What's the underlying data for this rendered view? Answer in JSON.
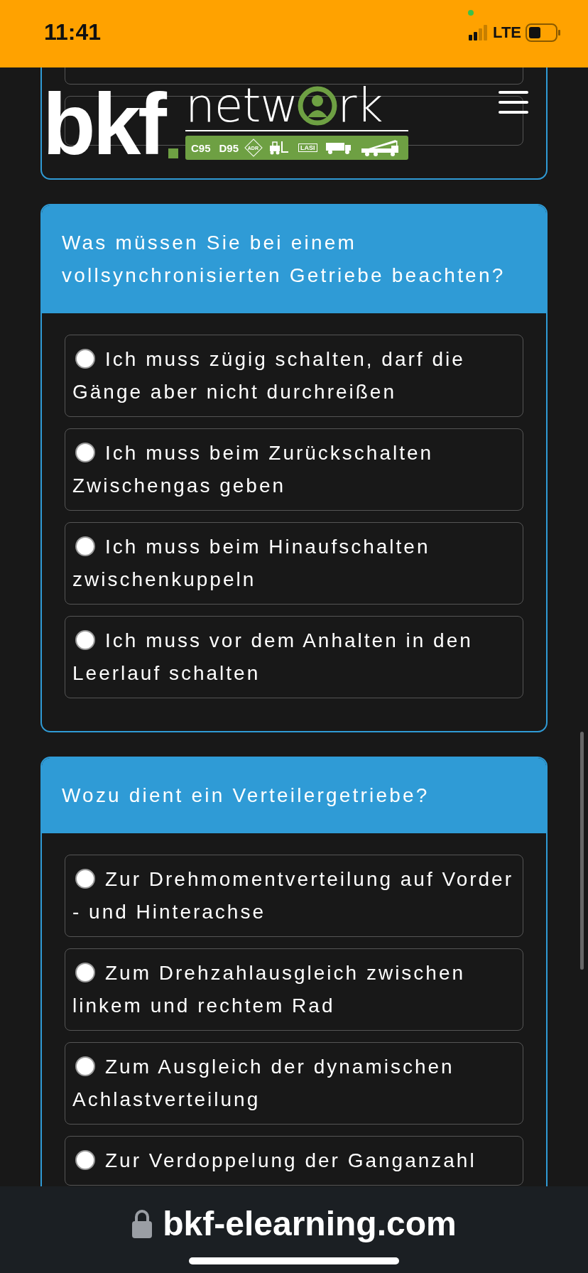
{
  "status_bar": {
    "time": "11:41",
    "network": "LTE"
  },
  "header": {
    "logo": {
      "brand": "bkf",
      "word_start": "netw",
      "word_end": "rk",
      "badges": [
        "C95",
        "D95",
        "ADR",
        "LASI"
      ]
    }
  },
  "questions": [
    {
      "options": [
        {
          "kind": "cut"
        },
        {
          "kind": "cut"
        }
      ]
    },
    {
      "question": "Was müssen Sie bei einem vollsynchronisierten Getriebe beachten?",
      "options": [
        {
          "kind": "radio",
          "text": "Ich muss zügig schalten, darf die Gänge aber nicht durchreißen",
          "selected": false
        },
        {
          "kind": "radio",
          "text": "Ich muss beim Zurückschalten Zwischengas geben",
          "selected": false
        },
        {
          "kind": "radio",
          "text": "Ich muss beim Hinaufschalten zwischenkuppeln",
          "selected": false
        },
        {
          "kind": "radio",
          "text": "Ich muss vor dem Anhalten in den Leerlauf schalten",
          "selected": false
        }
      ]
    },
    {
      "question": "Wozu dient ein Verteilergetriebe?",
      "options": [
        {
          "kind": "radio",
          "text": "Zur Drehmomentverteilung auf Vorder - und Hinterachse",
          "selected": false
        },
        {
          "kind": "radio",
          "text": "Zum Drehzahlausgleich zwischen linkem und rechtem Rad",
          "selected": false
        },
        {
          "kind": "radio",
          "text": "Zum Ausgleich der dynamischen Achlastverteilung",
          "selected": false
        },
        {
          "kind": "radio",
          "text": "Zur Verdoppelung der Ganganzahl",
          "selected": false
        }
      ]
    }
  ],
  "address_bar": {
    "url": "bkf-elearning.com"
  }
}
